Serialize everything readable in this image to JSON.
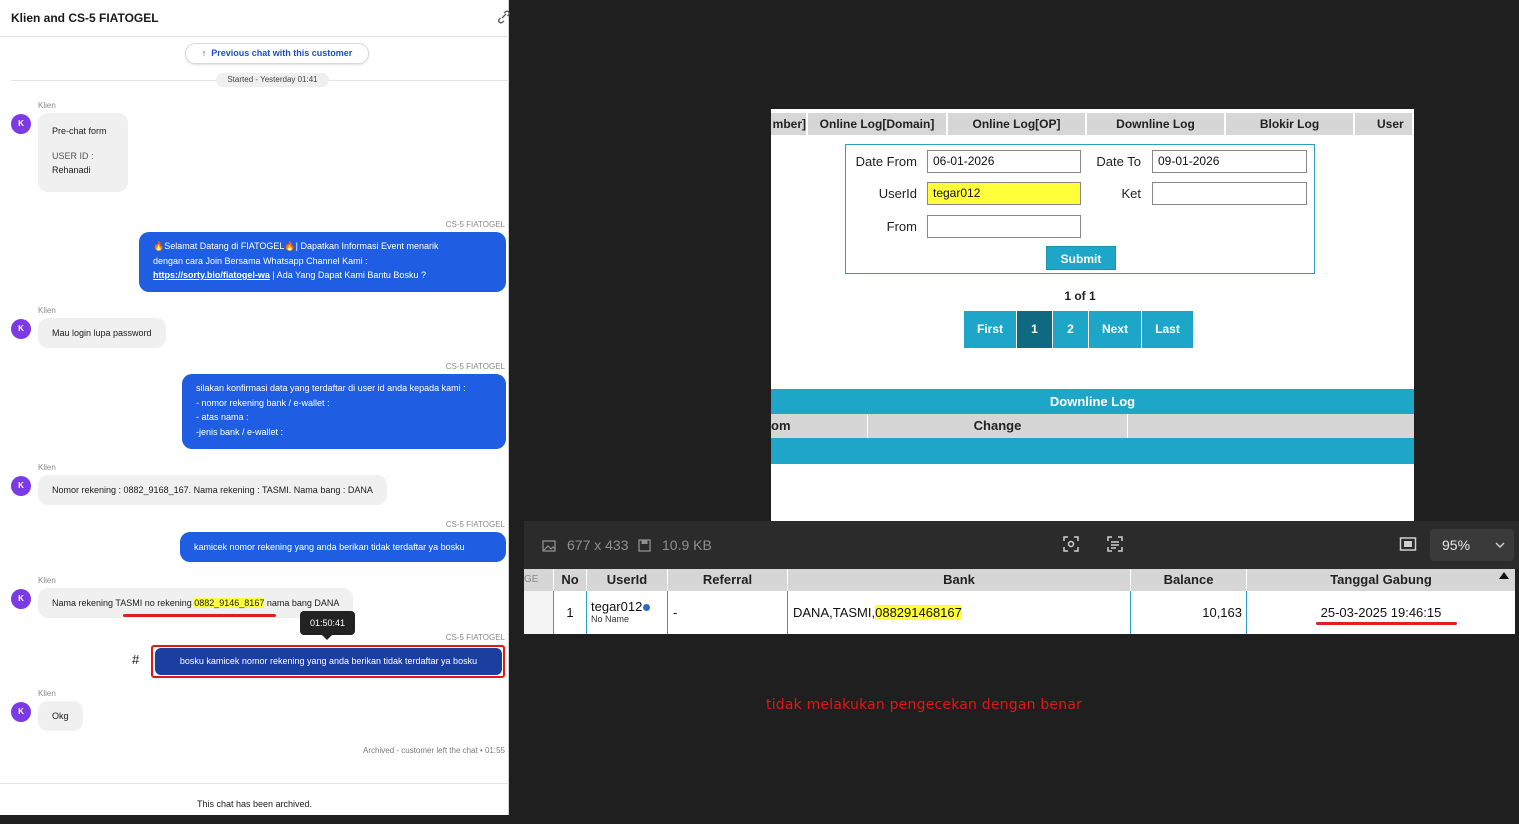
{
  "chat": {
    "title": "Klien and CS-5 FIATOGEL",
    "prev_chat_label": "Previous chat with this customer",
    "started_label": "Started - Yesterday 01:41",
    "client_name": "Klien",
    "agent_name": "CS-5 FIATOGEL",
    "avatar_letter": "K",
    "messages": [
      {
        "title": "Pre-chat form",
        "field_label": "USER ID :",
        "field_value": "Rehanadi"
      },
      {
        "line1": "🔥Selamat Datang di FIATOGEL🔥| Dapatkan Informasi Event menarik",
        "line2": "dengan cara Join Bersama Whatsapp Channel Kami :",
        "link": "https://sorty.bio/fiatogel-wa",
        "line3_rest": " | Ada Yang Dapat Kami Bantu Bosku ?"
      },
      {
        "text": "Mau login lupa password"
      },
      {
        "line1": "silakan konfirmasi data yang terdaftar di user id anda kepada kami :",
        "line2": "- nomor rekening bank / e-wallet :",
        "line3": "- atas nama :",
        "line4": "-jenis bank / e-wallet :"
      },
      {
        "text": "Nomor rekening : 0882_9168_167. Nama rekening : TASMI. Nama bang : DANA"
      },
      {
        "text": "kamicek nomor rekening yang anda berikan tidak terdaftar ya bosku"
      },
      {
        "before": "Nama rekening TASMI no rekening ",
        "highlight": "0882_9146_8167",
        "after": " nama bang DANA"
      },
      {
        "text": "bosku kamicek nomor rekening yang anda berikan tidak terdaftar ya bosku"
      },
      {
        "text": "Okg"
      }
    ],
    "tooltip_time": "01:50:41",
    "hash_symbol": "#",
    "archived_note": "Archived - customer left the chat • 01:55",
    "footer": "This chat has been archived."
  },
  "screenshot1": {
    "tabs": [
      "mber]",
      "Online Log[Domain]",
      "Online Log[OP]",
      "Downline Log",
      "Blokir Log",
      "User"
    ],
    "form": {
      "date_from_label": "Date From",
      "date_from_value": "06-01-2026",
      "date_to_label": "Date To",
      "date_to_value": "09-01-2026",
      "userid_label": "UserId",
      "userid_value": "tegar012",
      "ket_label": "Ket",
      "ket_value": "",
      "from_label": "From",
      "from_value": "",
      "submit_label": "Submit"
    },
    "page_of": "1 of 1",
    "pager": [
      "First",
      "1",
      "2",
      "Next",
      "Last"
    ],
    "downline_title": "Downline Log",
    "downline_cols": [
      "om",
      "Change",
      ""
    ]
  },
  "viewer": {
    "dimensions": "677 x 433",
    "file_size": "10.9 KB",
    "zoom": "95%"
  },
  "screenshot2": {
    "left_stub": "GE",
    "headers": [
      "No",
      "UserId",
      "Referral",
      "Bank",
      "Balance",
      "Tanggal Gabung"
    ],
    "row": {
      "no": "1",
      "userid": "tegar012",
      "name": "No Name",
      "referral": "-",
      "bank_prefix": "DANA,TASMI,",
      "bank_account": "088291468167",
      "balance": "10,163",
      "joined": "25-03-2025 19:46:15"
    }
  },
  "caption": "tidak melakukan pengecekan dengan benar",
  "colors": {
    "accent_blue": "#1f5ee3",
    "teal": "#1ea6c8",
    "highlight": "#ffff3a",
    "alert_red": "#e01818"
  }
}
